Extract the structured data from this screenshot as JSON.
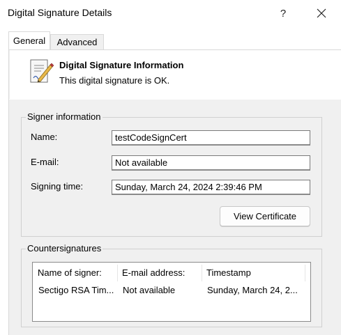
{
  "window": {
    "title": "Digital Signature Details",
    "help_label": "?",
    "close_label": "✕"
  },
  "tabs": [
    {
      "label": "General",
      "selected": true
    },
    {
      "label": "Advanced",
      "selected": false
    }
  ],
  "info": {
    "title": "Digital Signature Information",
    "status": "This digital signature is OK."
  },
  "signer": {
    "group_label": "Signer information",
    "name_label": "Name:",
    "name_value": "testCodeSignCert",
    "email_label": "E-mail:",
    "email_value": "Not available",
    "time_label": "Signing time:",
    "time_value": "Sunday, March 24, 2024 2:39:46 PM",
    "view_cert_label": "View Certificate"
  },
  "countersignatures": {
    "group_label": "Countersignatures",
    "columns": [
      "Name of signer:",
      "E-mail address:",
      "Timestamp"
    ],
    "rows": [
      [
        "Sectigo RSA Tim...",
        "Not available",
        "Sunday, March 24, 2..."
      ]
    ]
  },
  "colors": {
    "panel_bg": "#f0f0f0",
    "border": "#d0d0d0"
  }
}
